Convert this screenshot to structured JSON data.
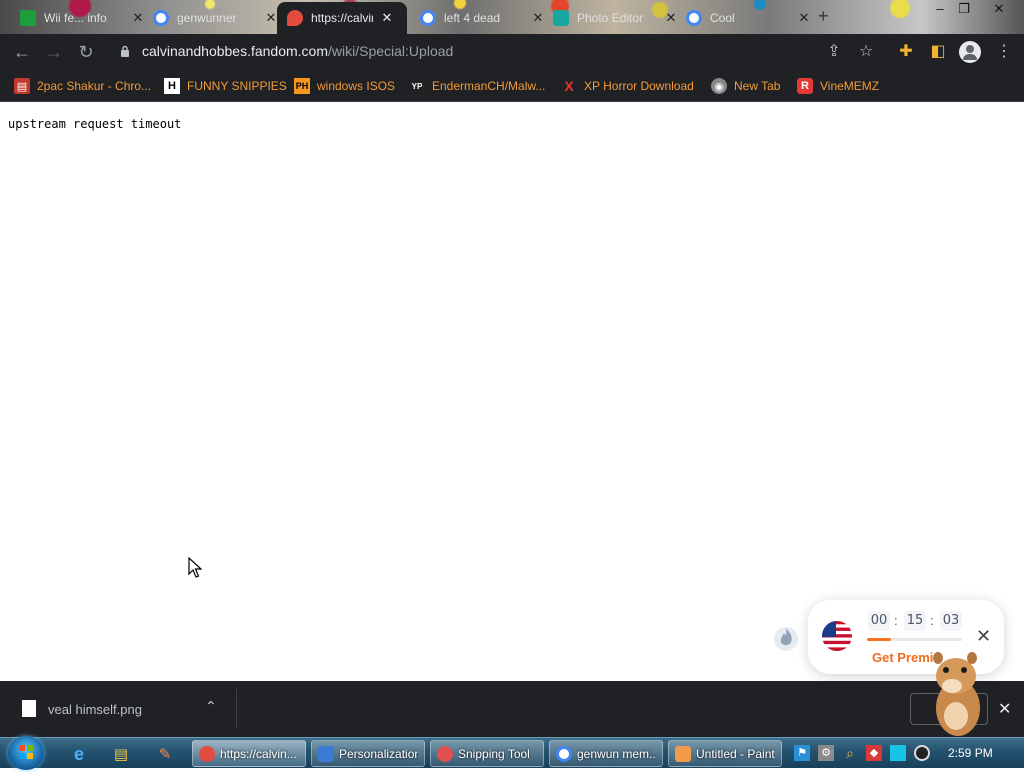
{
  "browser": {
    "tabs": [
      {
        "title": "Wii fe... info",
        "favicon_color": "#1e9e3a"
      },
      {
        "title": "genwunner",
        "favicon_color": "#4285f4"
      },
      {
        "title": "https://calvin",
        "favicon_color": "#e24c3f",
        "active": true
      },
      {
        "title": "left 4 dead",
        "favicon_color": "#4285f4"
      },
      {
        "title": "Photo Editor",
        "favicon_color": "#18a7a0"
      },
      {
        "title": "Cool",
        "favicon_color": "#4285f4"
      }
    ],
    "new_tab_glyph": "+",
    "window_controls": {
      "minimize": "–",
      "restore": "❐",
      "close": "✕"
    },
    "url_host": "calvinandhobbes.fandom.com",
    "url_path": "/wiki/Special:Upload",
    "toolbar_icons": [
      "share-icon",
      "star-icon",
      "extensions-icon",
      "sidebar-icon",
      "profile-icon",
      "menu-icon"
    ]
  },
  "bookmarks": [
    {
      "label": "2pac Shakur - Chro...",
      "icon": "R",
      "color": "#c0392b"
    },
    {
      "label": "FUNNY SNIPPIES",
      "icon": "H",
      "color": "#ffffff"
    },
    {
      "label": "windows ISOS",
      "icon": "PH",
      "color": "#f7971d"
    },
    {
      "label": "EndermanCH/Malw...",
      "icon": "YP",
      "color": "#ffffff"
    },
    {
      "label": "XP Horror Download",
      "icon": "X",
      "color": "#e53935"
    },
    {
      "label": "New Tab",
      "icon": "◉",
      "color": "#cccccc"
    },
    {
      "label": "VineMEMZ",
      "icon": "R",
      "color": "#e53935"
    }
  ],
  "page": {
    "message": "upstream request timeout"
  },
  "vpn": {
    "hours": "00",
    "minutes": "15",
    "seconds": "03",
    "separator": ":",
    "cta": "Get Premi",
    "progress": 0.25,
    "close_glyph": "✕"
  },
  "downloads": {
    "file_name": "veal himself.png",
    "chevron": "⌃",
    "close_glyph": "✕"
  },
  "taskbar": {
    "pinned": [
      {
        "name": "ie-icon",
        "glyph": "e",
        "color": "#4ab0ff"
      },
      {
        "name": "explorer-icon",
        "glyph": "▤",
        "color": "#f2c94c"
      },
      {
        "name": "paint-pinned-icon",
        "glyph": "✎",
        "color": "#ff8a4c"
      }
    ],
    "tasks": [
      {
        "label": "https://calvin...",
        "color": "#e24c3f",
        "active": true
      },
      {
        "label": "Personalization",
        "color": "#3a7bd5"
      },
      {
        "label": "Snipping Tool",
        "color": "#e05050"
      },
      {
        "label": "genwun mem...",
        "color": "#4285f4"
      },
      {
        "label": "Untitled - Paint",
        "color": "#f2994a"
      }
    ],
    "clock": "2:59 PM"
  }
}
